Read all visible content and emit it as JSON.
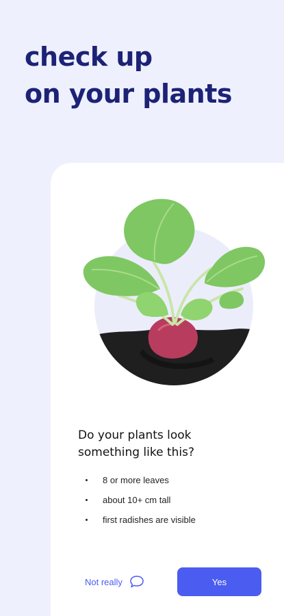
{
  "header": {
    "line1": "check up",
    "line2": "on your plants"
  },
  "card": {
    "question_line1": "Do your plants look",
    "question_line2": "something like this?",
    "criteria": [
      "8 or more leaves",
      "about 10+ cm tall",
      "first radishes are visible"
    ],
    "not_really_label": "Not really",
    "yes_label": "Yes"
  },
  "icons": {
    "feedback": "chat-bubble-icon",
    "illustration": "radish-seedling-illustration"
  },
  "colors": {
    "background": "#eef0fd",
    "headline": "#1c2275",
    "accent": "#4b5cf0",
    "card": "#ffffff"
  }
}
